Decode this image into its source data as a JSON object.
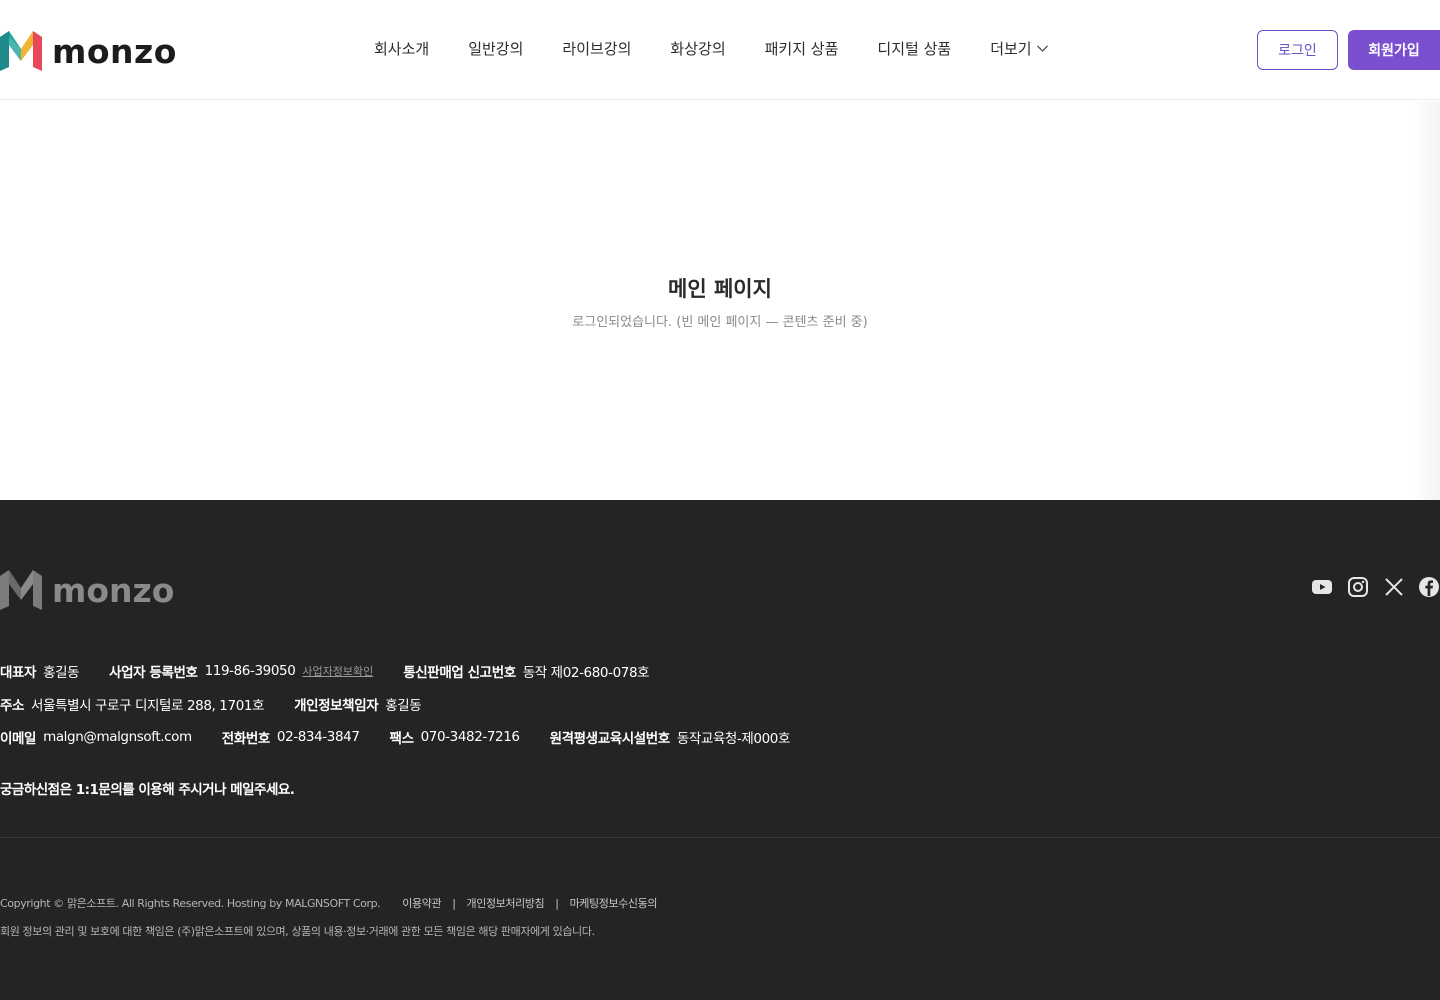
{
  "brand": {
    "name": "monzo",
    "colors": {
      "accent": "#7a4fd0",
      "accent_outline": "#6b4fc8",
      "footer_bg": "#242424"
    }
  },
  "nav": {
    "items": [
      "회사소개",
      "일반강의",
      "라이브강의",
      "화상강의",
      "패키지 상품",
      "디지털 상품"
    ],
    "more_label": "더보기"
  },
  "auth": {
    "login_label": "로그인",
    "signup_label": "회원가입"
  },
  "main": {
    "title": "메인 페이지",
    "subtitle": "로그인되었습니다. (빈 메인 페이지 — 콘텐츠 준비 중)"
  },
  "footer": {
    "social_icons": [
      "youtube-icon",
      "instagram-icon",
      "x-icon",
      "facebook-icon"
    ],
    "info": {
      "rep_label": "대표자",
      "rep_value": "홍길동",
      "bizno_label": "사업자 등록번호",
      "bizno_value": "119-86-39050",
      "bizno_link": "사업자정보확인",
      "ecom_label": "통신판매업 신고번호",
      "ecom_value": "동작 제02-680-078호",
      "addr_label": "주소",
      "addr_value": "서울특별시 구로구 디지털로 288, 1701호",
      "privacy_label": "개인정보책임자",
      "privacy_value": "홍길동",
      "email_label": "이메일",
      "email_value": "malgn@malgnsoft.com",
      "phone_label": "전화번호",
      "phone_value": "02-834-3847",
      "fax_label": "팩스",
      "fax_value": "070-3482-7216",
      "facility_label": "원격평생교육시설번호",
      "facility_value": "동작교육청-제000호"
    },
    "inquiry": "궁금하신점은 1:1문의를 이용해 주시거나 메일주세요.",
    "copyright": "Copyright © 맑은소프트. All Rights Reserved. Hosting by MALGNSOFT Corp.",
    "links": [
      "이용약관",
      "개인정보처리방침",
      "마케팅정보수신동의"
    ],
    "separator": "|",
    "disclaimer": "회원 정보의 관리 및 보호에 대한 책임은 (주)맑은소프트에 있으며, 상품의 내용·정보·거래에 관한 모든 책임은 해당 판매자에게 있습니다."
  }
}
